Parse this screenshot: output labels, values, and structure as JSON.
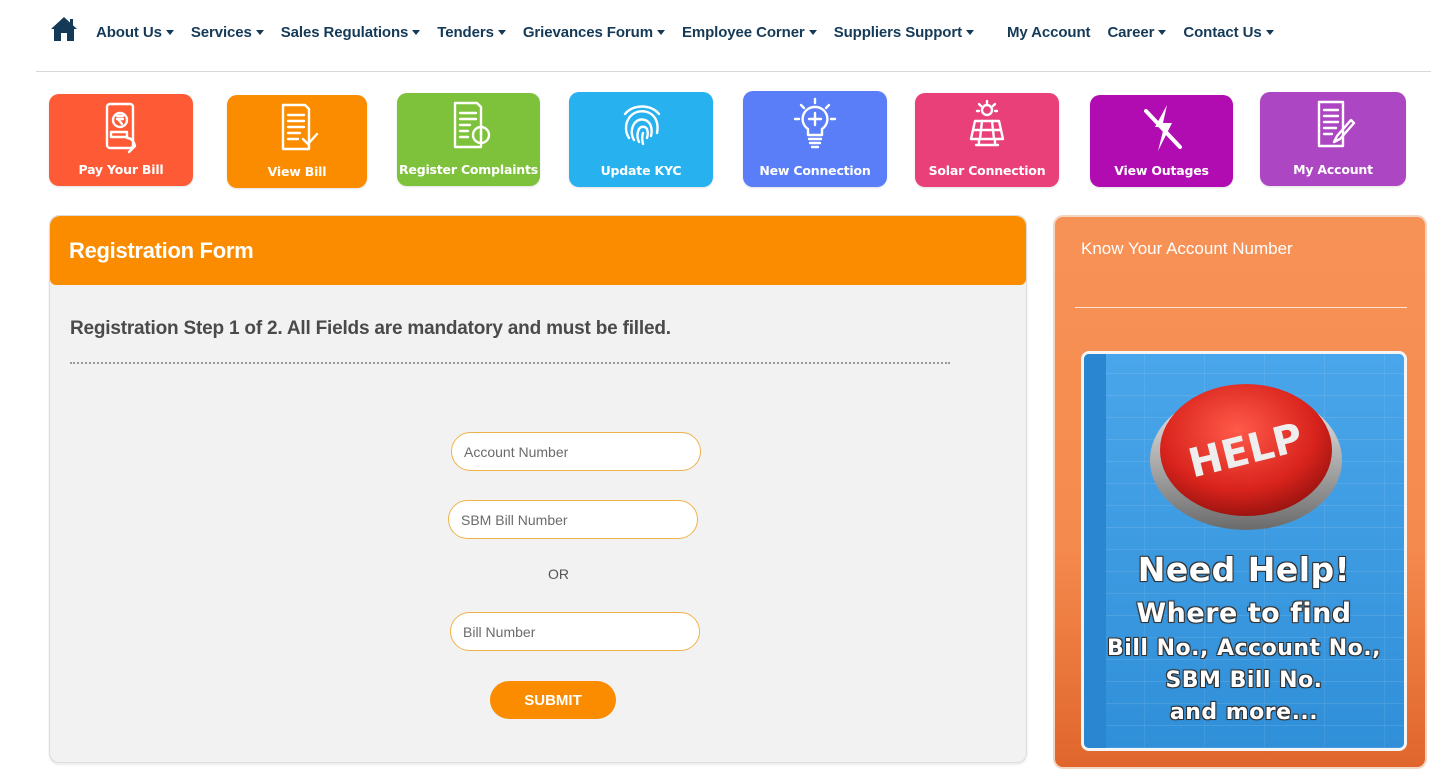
{
  "nav": {
    "home_icon": "home-icon",
    "items": [
      {
        "label": "About Us",
        "dropdown": true
      },
      {
        "label": "Services",
        "dropdown": true
      },
      {
        "label": "Sales Regulations",
        "dropdown": true
      },
      {
        "label": "Tenders",
        "dropdown": true
      },
      {
        "label": "Grievances Forum",
        "dropdown": true
      },
      {
        "label": "Employee Corner",
        "dropdown": true
      },
      {
        "label": "Suppliers Support",
        "dropdown": true
      },
      {
        "label": "My Account",
        "dropdown": false
      },
      {
        "label": "Career",
        "dropdown": true
      },
      {
        "label": "Contact Us",
        "dropdown": true
      }
    ]
  },
  "tiles": [
    {
      "label": "Pay Your Bill",
      "icon": "mobile-rupee-payment-icon",
      "color": "#ff5a36"
    },
    {
      "label": "View Bill",
      "icon": "bill-check-icon",
      "color": "#fb8c00"
    },
    {
      "label": "Register Complaints",
      "icon": "complaint-document-icon",
      "color": "#7dc23a"
    },
    {
      "label": "Update KYC",
      "icon": "fingerprint-icon",
      "color": "#27b1ef"
    },
    {
      "label": "New Connection",
      "icon": "lightbulb-plus-icon",
      "color": "#597ef7"
    },
    {
      "label": "Solar Connection",
      "icon": "solar-panel-icon",
      "color": "#e9407a"
    },
    {
      "label": "View Outages",
      "icon": "power-outage-icon",
      "color": "#b10bb2"
    },
    {
      "label": "My Account",
      "icon": "document-edit-icon",
      "color": "#ad46c2"
    }
  ],
  "registration": {
    "title": "Registration Form",
    "step_text": "Registration Step 1 of 2. All Fields are mandatory and must be filled.",
    "fields": {
      "account_number": {
        "placeholder": "Account Number",
        "value": ""
      },
      "sbm_bill_number": {
        "placeholder": "SBM Bill Number",
        "value": ""
      },
      "bill_number": {
        "placeholder": "Bill Number",
        "value": ""
      }
    },
    "or_label": "OR",
    "submit_label": "SUBMIT",
    "accent_color": "#fb8c00"
  },
  "side": {
    "title": "Know Your Account Number",
    "banner": {
      "button_text": "HELP",
      "line1": "Need Help!",
      "line2": "Where to find",
      "line3": "Bill No., Account No.,",
      "line4": "SBM Bill No.",
      "line5": "and more..."
    }
  }
}
